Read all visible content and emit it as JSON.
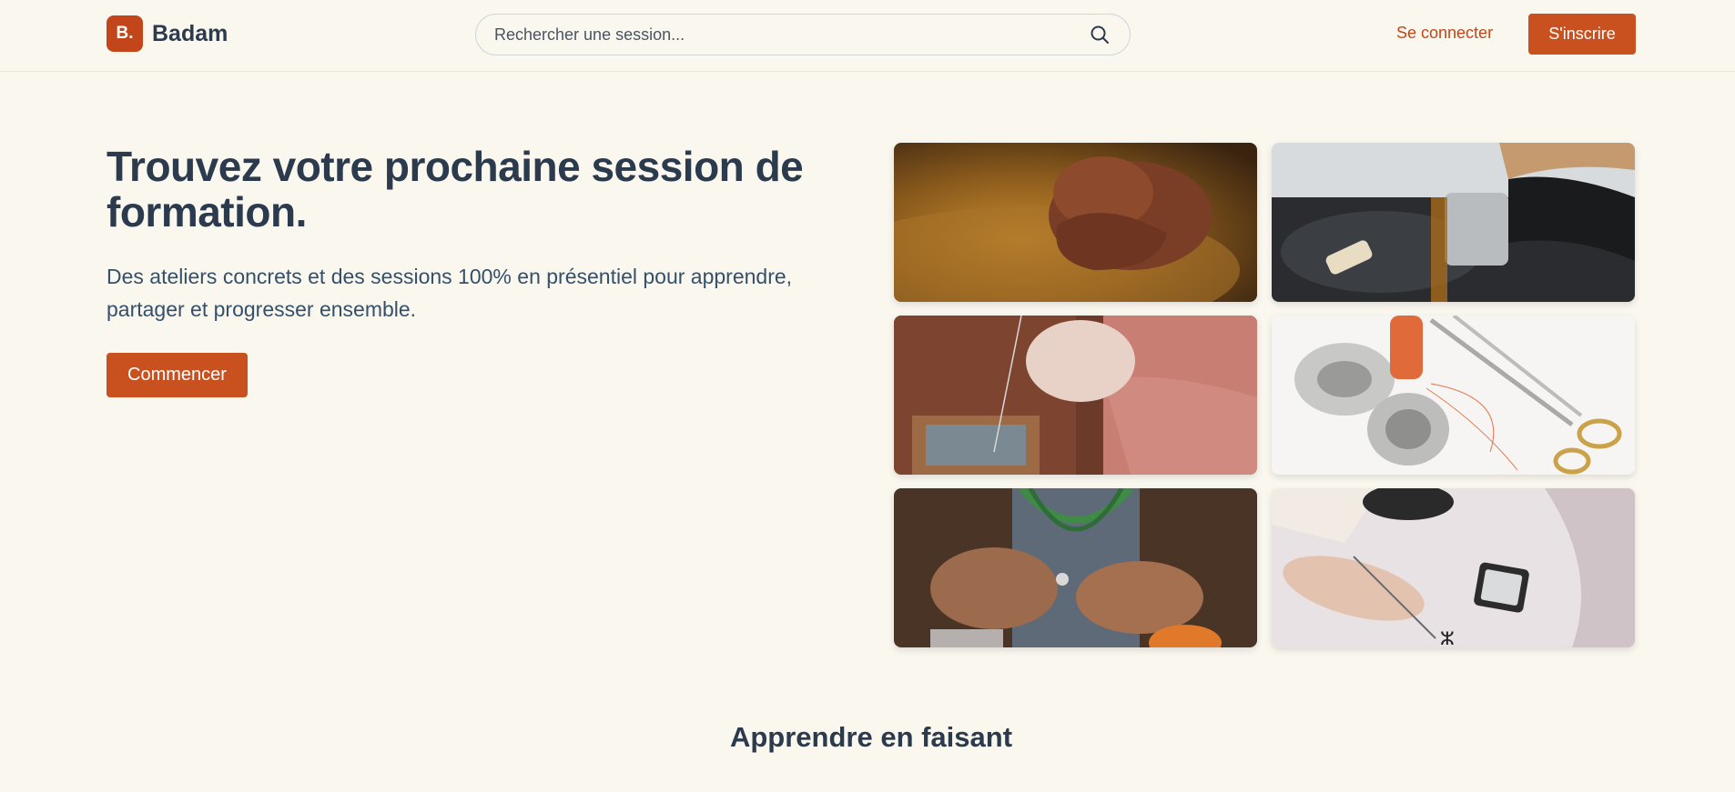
{
  "header": {
    "logo_mark": "B.",
    "brand": "Badam",
    "search_placeholder": "Rechercher une session...",
    "login": "Se connecter",
    "signup": "S'inscrire"
  },
  "hero": {
    "title": "Trouvez votre prochaine session de formation.",
    "subtitle": "Des ateliers concrets et des sessions 100% en présentiel pour apprendre, partager et progresser ensemble.",
    "cta": "Commencer"
  },
  "gallery": [
    {
      "subject": "pottery-wheel"
    },
    {
      "subject": "engine-oil-change"
    },
    {
      "subject": "beading-thread"
    },
    {
      "subject": "sewing-tools"
    },
    {
      "subject": "jewelry-making"
    },
    {
      "subject": "fabric-painting"
    }
  ],
  "section": {
    "title": "Apprendre en faisant"
  },
  "colors": {
    "accent": "#c9511f",
    "background": "#faf7ef",
    "text": "#2b3a4d"
  }
}
